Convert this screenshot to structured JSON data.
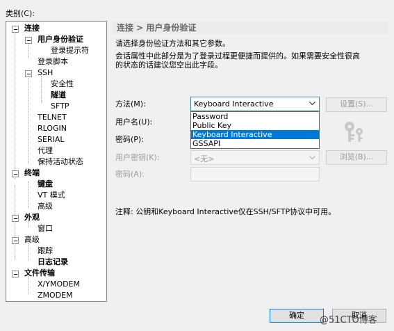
{
  "category_label": "类别(C):",
  "tree": {
    "nodes": [
      {
        "id": "conn",
        "label": "连接",
        "bold": true
      },
      {
        "id": "auth",
        "label": "用户身份验证",
        "bold": true
      },
      {
        "id": "prompt",
        "label": "登录提示符",
        "bold": false
      },
      {
        "id": "script",
        "label": "登录脚本",
        "bold": false
      },
      {
        "id": "ssh",
        "label": "SSH",
        "bold": false
      },
      {
        "id": "security",
        "label": "安全性",
        "bold": false
      },
      {
        "id": "tunnel",
        "label": "隧道",
        "bold": true
      },
      {
        "id": "sftp",
        "label": "SFTP",
        "bold": false
      },
      {
        "id": "telnet",
        "label": "TELNET",
        "bold": false
      },
      {
        "id": "rlogin",
        "label": "RLOGIN",
        "bold": false
      },
      {
        "id": "serial",
        "label": "SERIAL",
        "bold": false
      },
      {
        "id": "proxy",
        "label": "代理",
        "bold": false
      },
      {
        "id": "keepalive",
        "label": "保持活动状态",
        "bold": false
      },
      {
        "id": "terminal",
        "label": "终端",
        "bold": true
      },
      {
        "id": "keyboard",
        "label": "键盘",
        "bold": true
      },
      {
        "id": "vt",
        "label": "VT 模式",
        "bold": false
      },
      {
        "id": "advanced",
        "label": "高级",
        "bold": false
      },
      {
        "id": "appearance",
        "label": "外观",
        "bold": true
      },
      {
        "id": "window",
        "label": "窗口",
        "bold": false
      },
      {
        "id": "advanced2",
        "label": "高级",
        "bold": false
      },
      {
        "id": "trace",
        "label": "跟踪",
        "bold": false
      },
      {
        "id": "logging",
        "label": "日志记录",
        "bold": true
      },
      {
        "id": "transfer",
        "label": "文件传输",
        "bold": true
      },
      {
        "id": "xymodem",
        "label": "X/YMODEM",
        "bold": false
      },
      {
        "id": "zmodem",
        "label": "ZMODEM",
        "bold": false
      }
    ]
  },
  "panel": {
    "header": "连接 > 用户身份验证",
    "description1": "请选择身份验证方法和其它参数。",
    "description2": "会话属性中此部分是为了登录过程更便捷而提供的。如果需要安全性很高",
    "description3": "的状态的话建议您空出此字段。",
    "method_label": "方法(M):",
    "method_value": "Keyboard Interactive",
    "method_options": [
      "Password",
      "Public Key",
      "Keyboard Interactive",
      "GSSAPI"
    ],
    "method_selected_index": 2,
    "settings_button": "设置(S)...",
    "username_label": "用户名(U):",
    "password_label": "密码(P):",
    "user_key_label": "用户密钥(K):",
    "user_key_value": "<无>",
    "browse_button": "浏览(B)...",
    "passphrase_label": "密码(A):",
    "note": "注释: 公钥和Keyboard Interactive仅在SSH/SFTP协议中可用。"
  },
  "footer": {
    "ok_button": "确定",
    "cancel_button": "取消",
    "watermark": "@51CTO博客"
  },
  "icons": {
    "key": "key-icon"
  }
}
